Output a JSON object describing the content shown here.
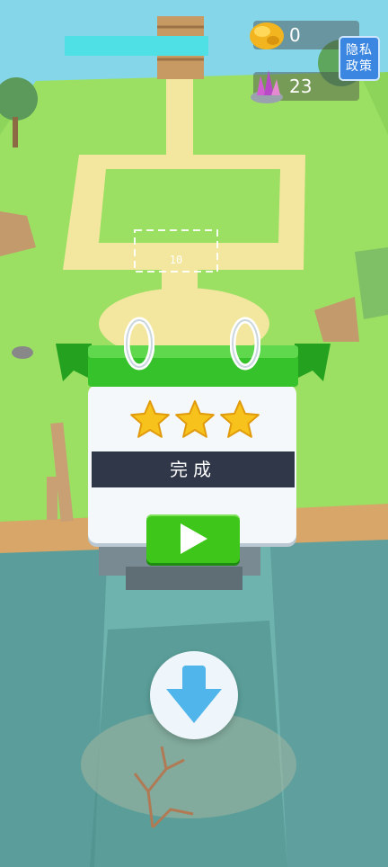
{
  "hud": {
    "level_progress": 1.0,
    "gold_count": "0",
    "gem_count": "23",
    "gold_icon": "gold-nugget-icon",
    "gem_icon": "crystal-gem-icon"
  },
  "privacy": {
    "line1": "隐私",
    "line2": "政策"
  },
  "result": {
    "stars_earned": 3,
    "stars_total": 3,
    "status_text": "完成",
    "play_icon": "play-icon"
  },
  "ground_marker": {
    "value": "10"
  },
  "controls": {
    "down_icon": "down-arrow-icon"
  },
  "colors": {
    "accent": "#3ec61a",
    "banner": "#2fb82a",
    "status_bar": "#2f3748",
    "cyan_bar": "#4fe0e6"
  }
}
